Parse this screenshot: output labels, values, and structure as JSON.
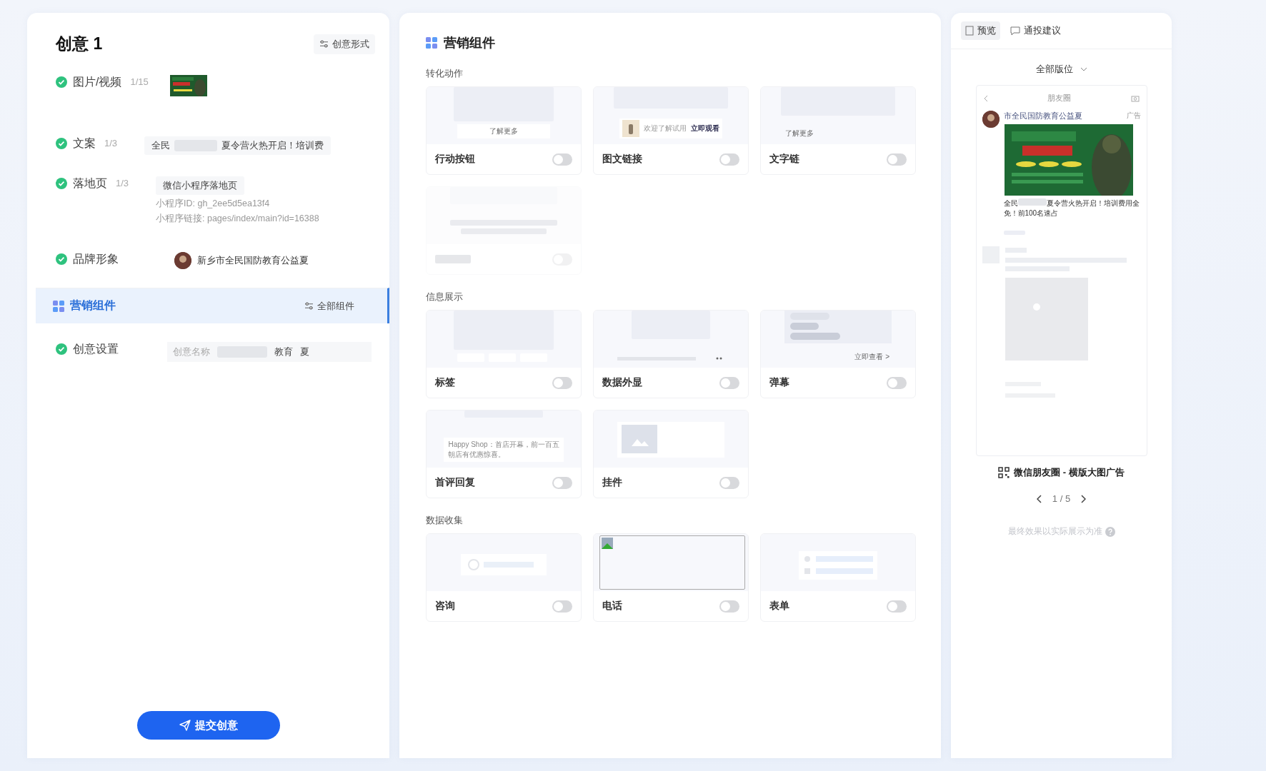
{
  "left": {
    "title": "创意 1",
    "format_button": "创意形式",
    "rows": [
      {
        "kind": "media",
        "label": "图片/视频",
        "count": "1/15",
        "done": true,
        "selected": false
      },
      {
        "kind": "text",
        "label": "文案",
        "count": "1/3",
        "done": true,
        "selected": false,
        "value_parts": [
          "全民",
          "夏令营火热开启！培训费"
        ]
      },
      {
        "kind": "landing",
        "label": "落地页",
        "count": "1/3",
        "done": true,
        "selected": false,
        "value": "微信小程序落地页",
        "details": [
          "小程序ID: gh_2ee5d5ea13f4",
          "小程序链接: pages/index/main?id=16388"
        ]
      },
      {
        "kind": "brand",
        "label": "品牌形象",
        "done": true,
        "selected": false,
        "value": "新乡市全民国防教育公益夏"
      },
      {
        "kind": "section",
        "label": "营销组件",
        "selected": true,
        "action": "全部组件"
      },
      {
        "kind": "field",
        "label": "创意设置",
        "done": true,
        "selected": false,
        "field_label": "创意名称",
        "value_parts": [
          "教育",
          "夏"
        ]
      }
    ],
    "submit": "提交创意"
  },
  "middle": {
    "title": "营销组件",
    "groups": [
      {
        "title": "转化动作",
        "items": [
          {
            "label": "行动按钮",
            "on": false,
            "disabled": false,
            "kind": "button",
            "texts": [
              "了解更多"
            ]
          },
          {
            "label": "图文链接",
            "on": false,
            "disabled": false,
            "kind": "imagelink",
            "texts": [
              "欢迎了解试用",
              "立即观看"
            ]
          },
          {
            "label": "文字链",
            "on": false,
            "disabled": false,
            "kind": "textlink",
            "texts": [
              "了解更多"
            ]
          },
          {
            "on": false,
            "disabled": true,
            "kind": "faded"
          }
        ]
      },
      {
        "title": "信息展示",
        "items": [
          {
            "label": "标签",
            "on": false,
            "disabled": false,
            "kind": "tags"
          },
          {
            "label": "数据外显",
            "on": false,
            "disabled": false,
            "kind": "data"
          },
          {
            "label": "弹幕",
            "on": false,
            "disabled": false,
            "kind": "danmaku",
            "texts": [
              "立即查看 >"
            ]
          },
          {
            "label": "首评回复",
            "on": false,
            "disabled": false,
            "kind": "reply",
            "texts": [
              "Happy Shop：首店开幕，前一百五",
              "朝店有优惠惊喜。"
            ]
          },
          {
            "label": "挂件",
            "on": false,
            "disabled": false,
            "kind": "widget"
          }
        ]
      },
      {
        "title": "数据收集",
        "items": [
          {
            "label": "咨询",
            "on": false,
            "disabled": false,
            "kind": "consult"
          },
          {
            "label": "电话",
            "on": false,
            "disabled": false,
            "kind": "broken"
          },
          {
            "label": "表单",
            "on": false,
            "disabled": false,
            "kind": "form"
          }
        ]
      }
    ]
  },
  "right": {
    "tabs": [
      {
        "label": "预览",
        "selected": true
      },
      {
        "label": "通投建议",
        "selected": false
      }
    ],
    "placement": "全部版位",
    "phone": {
      "nav_title": "朋友圈",
      "account": "市全民国防教育公益夏",
      "ad_tag": "广告",
      "caption_parts": [
        "全民",
        "夏令营火热开启！培训费用全免！前100名速占"
      ]
    },
    "format": "微信朋友圈 - 横版大图广告",
    "pager": "1 / 5",
    "note": "最终效果以实际展示为准"
  }
}
